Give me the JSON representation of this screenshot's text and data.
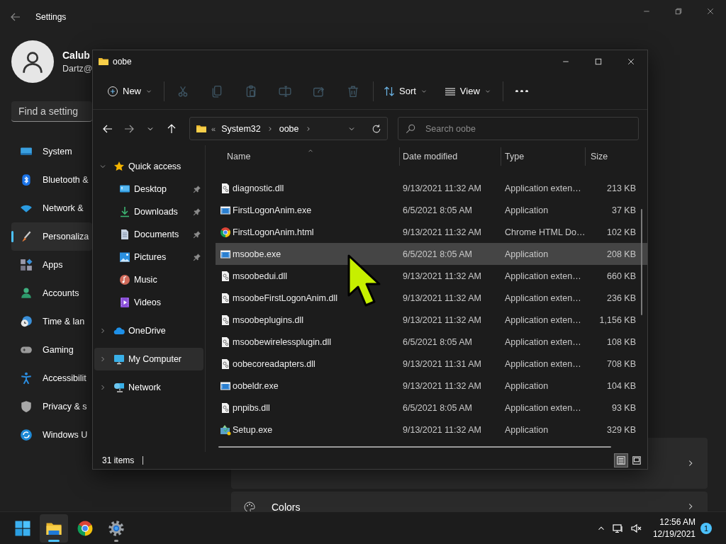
{
  "settings": {
    "title": "Settings",
    "user": {
      "name": "Calub",
      "email": "Dartz@"
    },
    "search": {
      "placeholder": "Find a setting"
    },
    "nav": [
      {
        "label": "System",
        "selected": false
      },
      {
        "label": "Bluetooth &",
        "selected": false
      },
      {
        "label": "Network &",
        "selected": false
      },
      {
        "label": "Personaliza",
        "selected": true
      },
      {
        "label": "Apps",
        "selected": false
      },
      {
        "label": "Accounts",
        "selected": false
      },
      {
        "label": "Time & lan",
        "selected": false
      },
      {
        "label": "Gaming",
        "selected": false
      },
      {
        "label": "Accessibilit",
        "selected": false
      },
      {
        "label": "Privacy & s",
        "selected": false
      },
      {
        "label": "Windows U",
        "selected": false
      }
    ],
    "cards": [
      {
        "kind": "plain"
      },
      {
        "kind": "titled",
        "title": "Colors"
      }
    ]
  },
  "explorer": {
    "title": "oobe",
    "toolbar": [
      {
        "kind": "menu",
        "label": "New"
      },
      {
        "kind": "separator"
      },
      {
        "kind": "action",
        "disabled": true
      },
      {
        "kind": "action",
        "disabled": true
      },
      {
        "kind": "action",
        "disabled": true
      },
      {
        "kind": "action",
        "disabled": true
      },
      {
        "kind": "action",
        "disabled": true
      },
      {
        "kind": "action",
        "disabled": true
      },
      {
        "kind": "separator"
      },
      {
        "kind": "menu",
        "label": "Sort"
      },
      {
        "kind": "menu",
        "label": "View"
      },
      {
        "kind": "separator"
      },
      {
        "kind": "more"
      }
    ],
    "address": {
      "overflow": "«",
      "path": [
        "System32",
        "oobe"
      ]
    },
    "search": {
      "placeholder": "Search oobe"
    },
    "nav": [
      {
        "label": "Quick access",
        "expanded": true,
        "selected": false,
        "children": [
          {
            "label": "Desktop",
            "pinned": true,
            "selected": false
          },
          {
            "label": "Downloads",
            "pinned": true,
            "selected": false
          },
          {
            "label": "Documents",
            "pinned": true,
            "selected": false
          },
          {
            "label": "Pictures",
            "pinned": true,
            "selected": false
          },
          {
            "label": "Music",
            "pinned": false,
            "selected": false
          },
          {
            "label": "Videos",
            "pinned": false,
            "selected": false
          }
        ]
      },
      {
        "label": "OneDrive",
        "expanded": false,
        "selected": false
      },
      {
        "label": "My Computer",
        "expanded": false,
        "selected": true
      },
      {
        "label": "Network",
        "expanded": false,
        "selected": false
      }
    ],
    "columns": [
      {
        "label": "Name",
        "sorted": true
      },
      {
        "label": "Date modified",
        "sorted": false
      },
      {
        "label": "Type",
        "sorted": false
      },
      {
        "label": "Size",
        "sorted": false
      }
    ],
    "rows": [
      {
        "kind": "library",
        "name": "diagnostic.dll",
        "date": "9/13/2021 11:32 AM",
        "type": "Application exten…",
        "size": "213 KB",
        "selected": false
      },
      {
        "kind": "application",
        "name": "FirstLogonAnim.exe",
        "date": "6/5/2021 8:05 AM",
        "type": "Application",
        "size": "37 KB",
        "selected": false
      },
      {
        "kind": "webpage",
        "name": "FirstLogonAnim.html",
        "date": "9/13/2021 11:32 AM",
        "type": "Chrome HTML Do…",
        "size": "102 KB",
        "selected": false
      },
      {
        "kind": "application",
        "name": "msoobe.exe",
        "date": "6/5/2021 8:05 AM",
        "type": "Application",
        "size": "208 KB",
        "selected": true
      },
      {
        "kind": "library",
        "name": "msoobedui.dll",
        "date": "9/13/2021 11:32 AM",
        "type": "Application exten…",
        "size": "660 KB",
        "selected": false
      },
      {
        "kind": "library",
        "name": "msoobeFirstLogonAnim.dll",
        "date": "9/13/2021 11:32 AM",
        "type": "Application exten…",
        "size": "236 KB",
        "selected": false
      },
      {
        "kind": "library",
        "name": "msoobeplugins.dll",
        "date": "9/13/2021 11:32 AM",
        "type": "Application exten…",
        "size": "1,156 KB",
        "selected": false
      },
      {
        "kind": "library",
        "name": "msoobewirelessplugin.dll",
        "date": "6/5/2021 8:05 AM",
        "type": "Application exten…",
        "size": "108 KB",
        "selected": false
      },
      {
        "kind": "library",
        "name": "oobecoreadapters.dll",
        "date": "9/13/2021 11:31 AM",
        "type": "Application exten…",
        "size": "708 KB",
        "selected": false
      },
      {
        "kind": "application",
        "name": "oobeldr.exe",
        "date": "9/13/2021 11:32 AM",
        "type": "Application",
        "size": "104 KB",
        "selected": false
      },
      {
        "kind": "library",
        "name": "pnpibs.dll",
        "date": "6/5/2021 8:05 AM",
        "type": "Application exten…",
        "size": "93 KB",
        "selected": false
      },
      {
        "kind": "installer",
        "name": "Setup.exe",
        "date": "9/13/2021 11:32 AM",
        "type": "Application",
        "size": "329 KB",
        "selected": false
      }
    ],
    "status": {
      "count": "31 items"
    },
    "view_buttons": [
      {
        "kind": "details",
        "selected": true
      },
      {
        "kind": "tiles",
        "selected": false
      }
    ]
  },
  "taskbar": {
    "apps": [
      {
        "active": false,
        "running": false
      },
      {
        "active": true,
        "running": true
      },
      {
        "active": false,
        "running": false
      },
      {
        "active": false,
        "running": true
      }
    ],
    "tray": {
      "time": "12:56 AM",
      "date": "12/19/2021",
      "badge": "1"
    }
  }
}
